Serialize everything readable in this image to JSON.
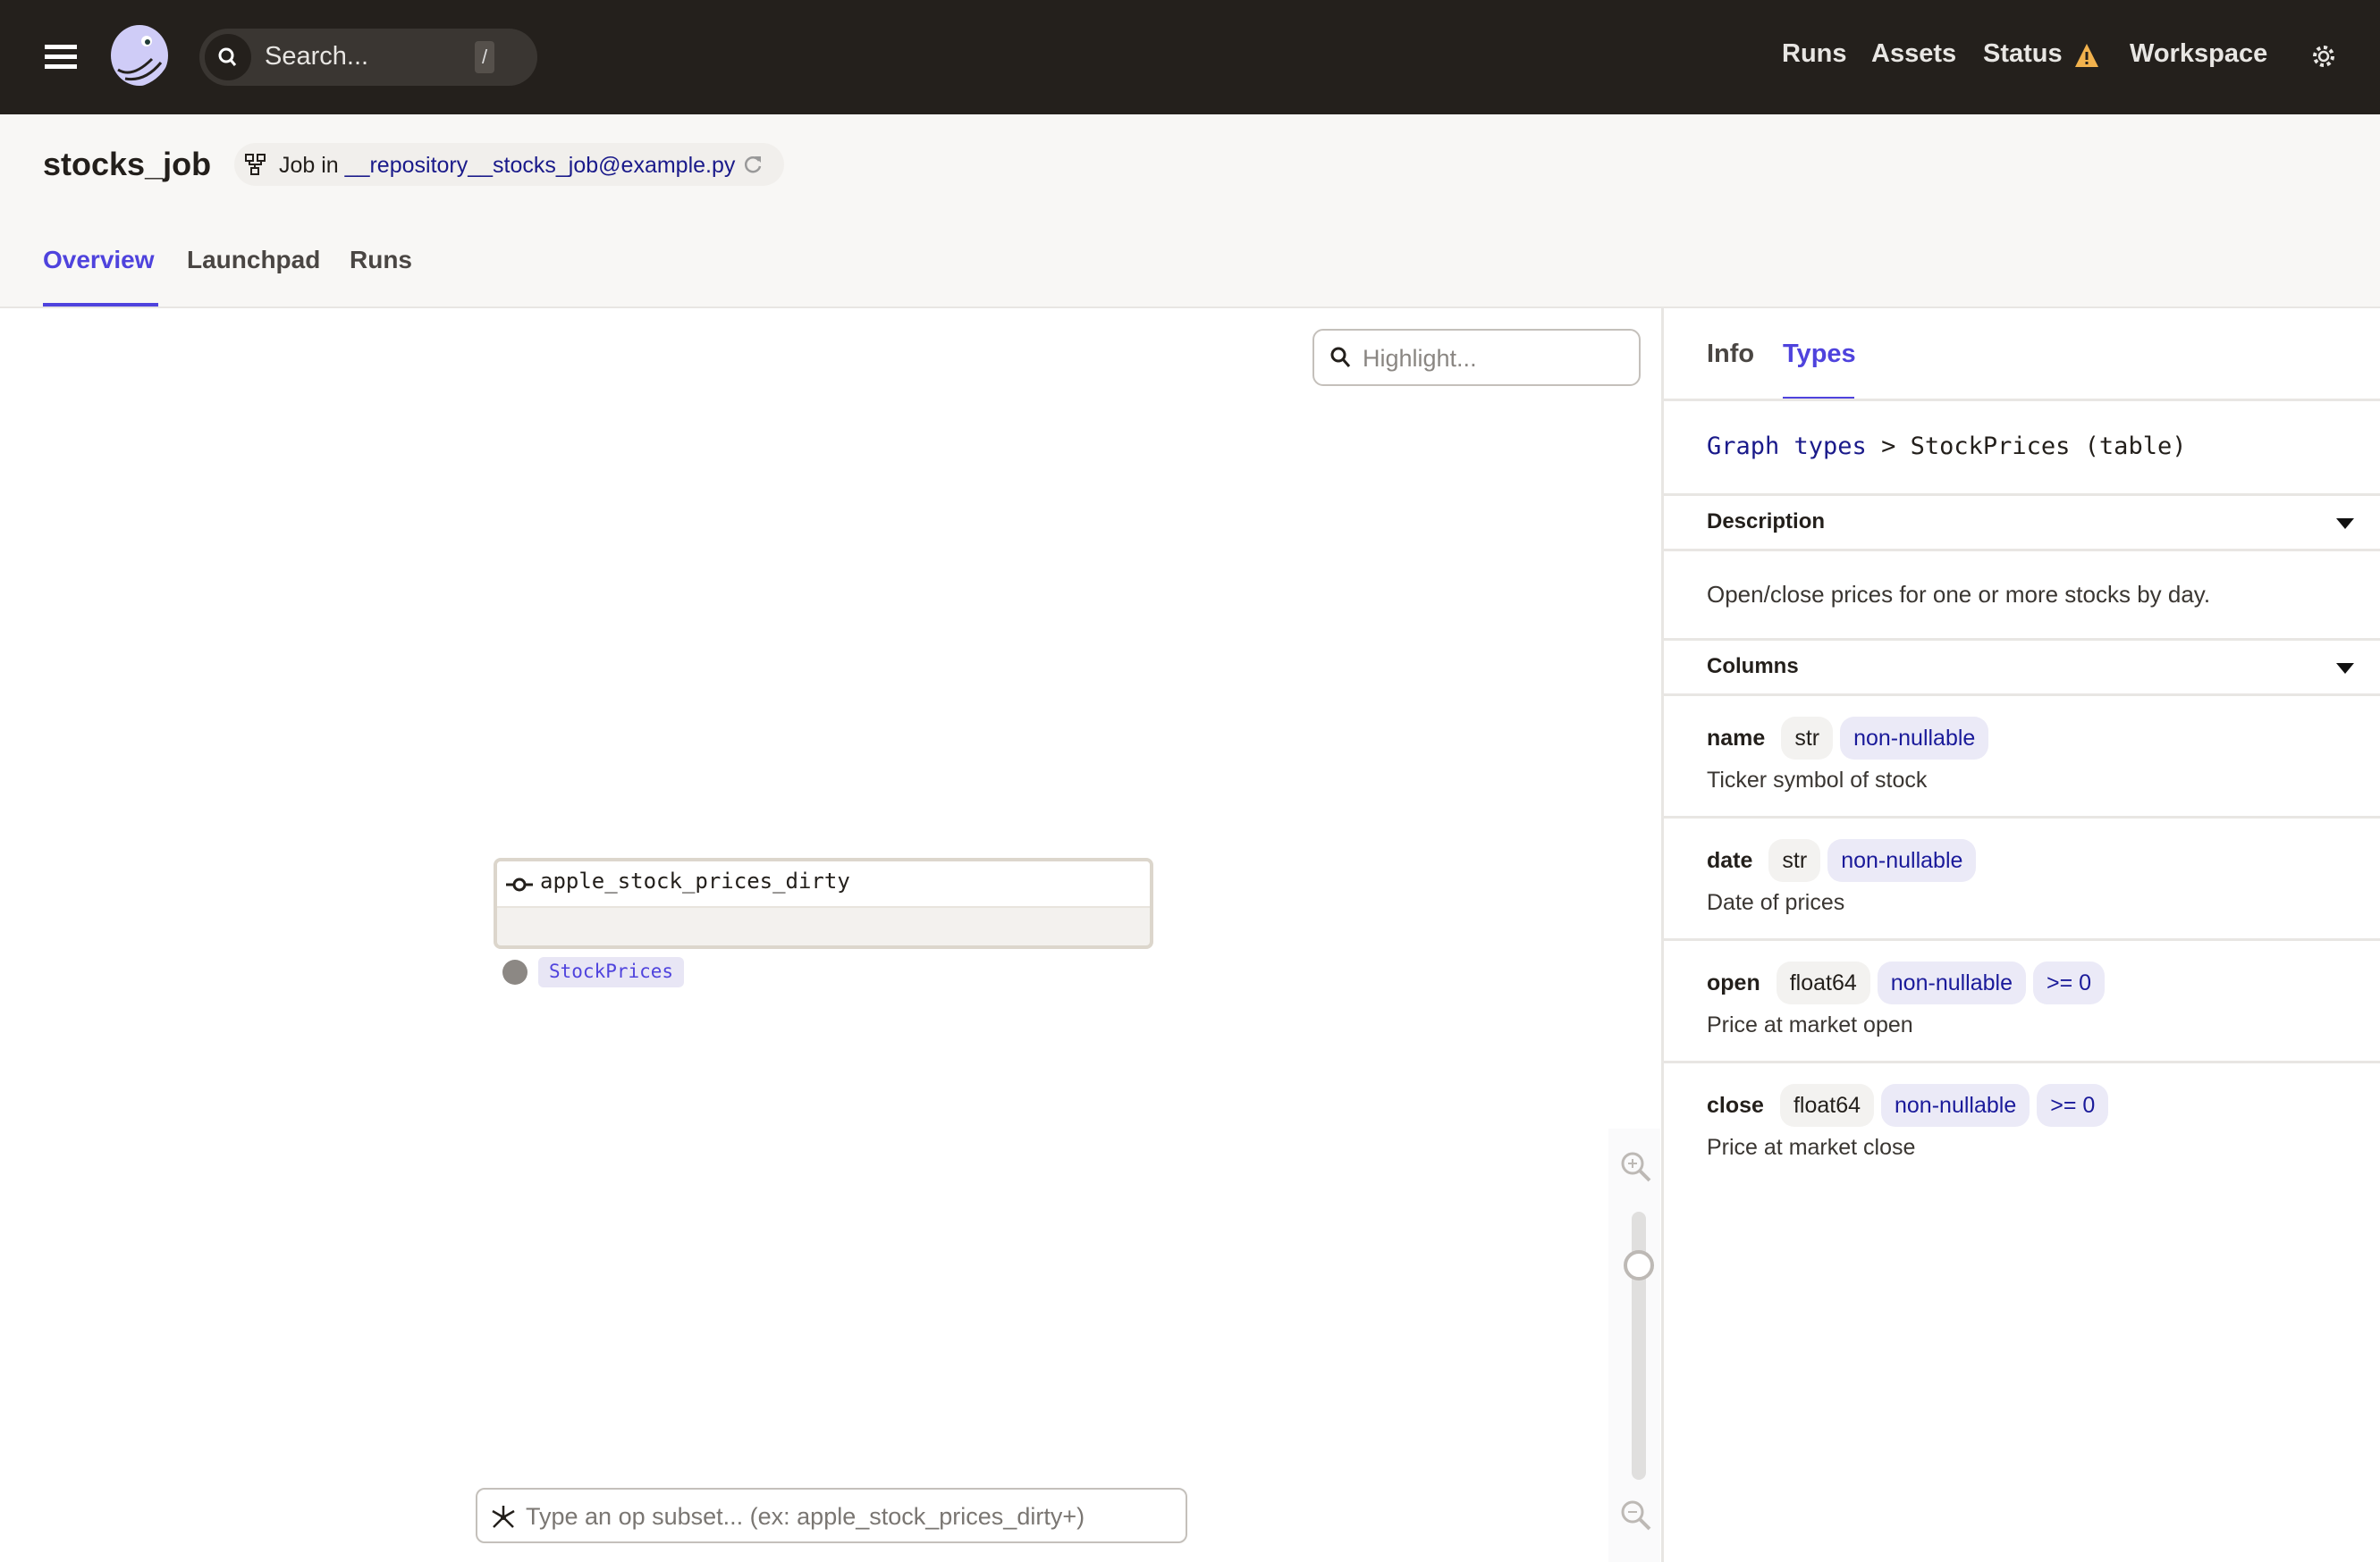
{
  "topbar": {
    "search_placeholder": "Search...",
    "search_shortcut": "/",
    "nav": [
      {
        "label": "Runs"
      },
      {
        "label": "Assets"
      },
      {
        "label": "Status"
      },
      {
        "label": "Workspace"
      }
    ],
    "status_icon": "warning-icon",
    "status_color": "#f2b24d",
    "settings_icon": "gear-icon"
  },
  "header": {
    "title": "stocks_job",
    "job_prefix": "Job in",
    "repository": "__repository__stocks_job@example.py",
    "tabs": [
      {
        "label": "Overview",
        "active": true
      },
      {
        "label": "Launchpad"
      },
      {
        "label": "Runs"
      }
    ]
  },
  "graph": {
    "highlight_placeholder": "Highlight...",
    "node": {
      "name": "apple_stock_prices_dirty",
      "output_type": "StockPrices"
    },
    "op_subset_placeholder": "Type an op subset... (ex: apple_stock_prices_dirty+)",
    "zoom_level": 0.8
  },
  "sidebar": {
    "tabs": [
      {
        "label": "Info"
      },
      {
        "label": "Types",
        "active": true
      }
    ],
    "breadcrumb": {
      "root": "Graph types",
      "separator": ">",
      "current": "StockPrices (table)"
    },
    "description_label": "Description",
    "description": "Open/close prices for one or more stocks by day.",
    "columns_label": "Columns",
    "columns": [
      {
        "name": "name",
        "type": "str",
        "constraints": [
          "non-nullable"
        ],
        "description": "Ticker symbol of stock"
      },
      {
        "name": "date",
        "type": "str",
        "constraints": [
          "non-nullable"
        ],
        "description": "Date of prices"
      },
      {
        "name": "open",
        "type": "float64",
        "constraints": [
          "non-nullable",
          ">= 0"
        ],
        "description": "Price at market open"
      },
      {
        "name": "close",
        "type": "float64",
        "constraints": [
          "non-nullable",
          ">= 0"
        ],
        "description": "Price at market close"
      }
    ]
  },
  "colors": {
    "accent": "#4f43dd",
    "topbar": "#24201c",
    "link": "#1a1a8a"
  }
}
